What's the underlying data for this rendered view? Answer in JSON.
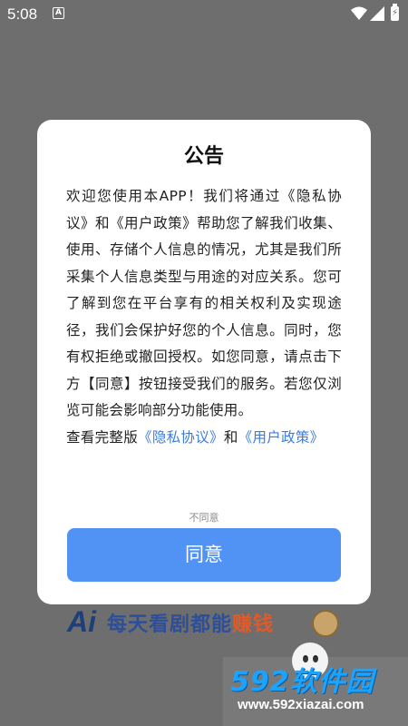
{
  "status_bar": {
    "time": "5:08",
    "notification_icon": "A"
  },
  "dialog": {
    "title": "公告",
    "body_text": "欢迎您使用本APP！我们将通过《隐私协议》和《用户政策》帮助您了解我们收集、使用、存储个人信息的情况，尤其是我们所采集个人信息类型与用途的对应关系。您可了解到您在平台享有的相关权利及实现途径，我们会保护好您的个人信息。同时，您有权拒绝或撤回授权。如您同意，请点击下方【同意】按钮接受我们的服务。若您仅浏览可能会影响部分功能使用。",
    "links_prefix": "查看完整版",
    "privacy_link": "《隐私协议》",
    "links_joiner": "和",
    "user_policy_link": "《用户政策》",
    "disagree_label": "不同意",
    "agree_label": "同意",
    "accent_color": "#5193f5"
  },
  "background_banner": {
    "logo": "Ai",
    "text_part1": "每天看剧都能",
    "text_highlight": "赚钱"
  },
  "watermark": {
    "title": "592软件园",
    "url": "www.592xiazai.com"
  }
}
